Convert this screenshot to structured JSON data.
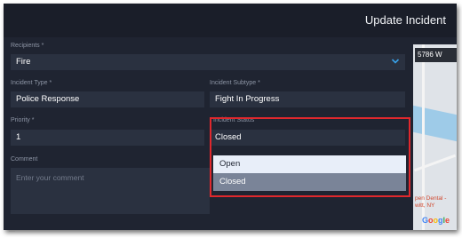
{
  "header": {
    "title": "Update Incident"
  },
  "form": {
    "recipients": {
      "label": "Recipients *",
      "value": "Fire"
    },
    "incident_type": {
      "label": "Incident Type *",
      "value": "Police Response"
    },
    "incident_subtype": {
      "label": "Incident Subtype *",
      "value": "Fight In Progress"
    },
    "priority": {
      "label": "Priority *",
      "value": "1"
    },
    "incident_status": {
      "label": "Incident Status",
      "value": "Closed"
    },
    "comment": {
      "label": "Comment",
      "placeholder": "Enter your comment"
    }
  },
  "status_dropdown": {
    "options": [
      "Open",
      "Closed"
    ],
    "highlighted_option": "Open",
    "selected_option": "Closed"
  },
  "map": {
    "address": "5786 W",
    "poi_lines": [
      "pen Dental -",
      "witt, NY"
    ],
    "logo": "Google"
  },
  "colors": {
    "background": "#1f2431",
    "field": "#2a3140",
    "accent": "#38a1e8",
    "highlight_border": "#e0282d"
  },
  "icons": {
    "recipients_chevron": "chevron-down-icon"
  }
}
